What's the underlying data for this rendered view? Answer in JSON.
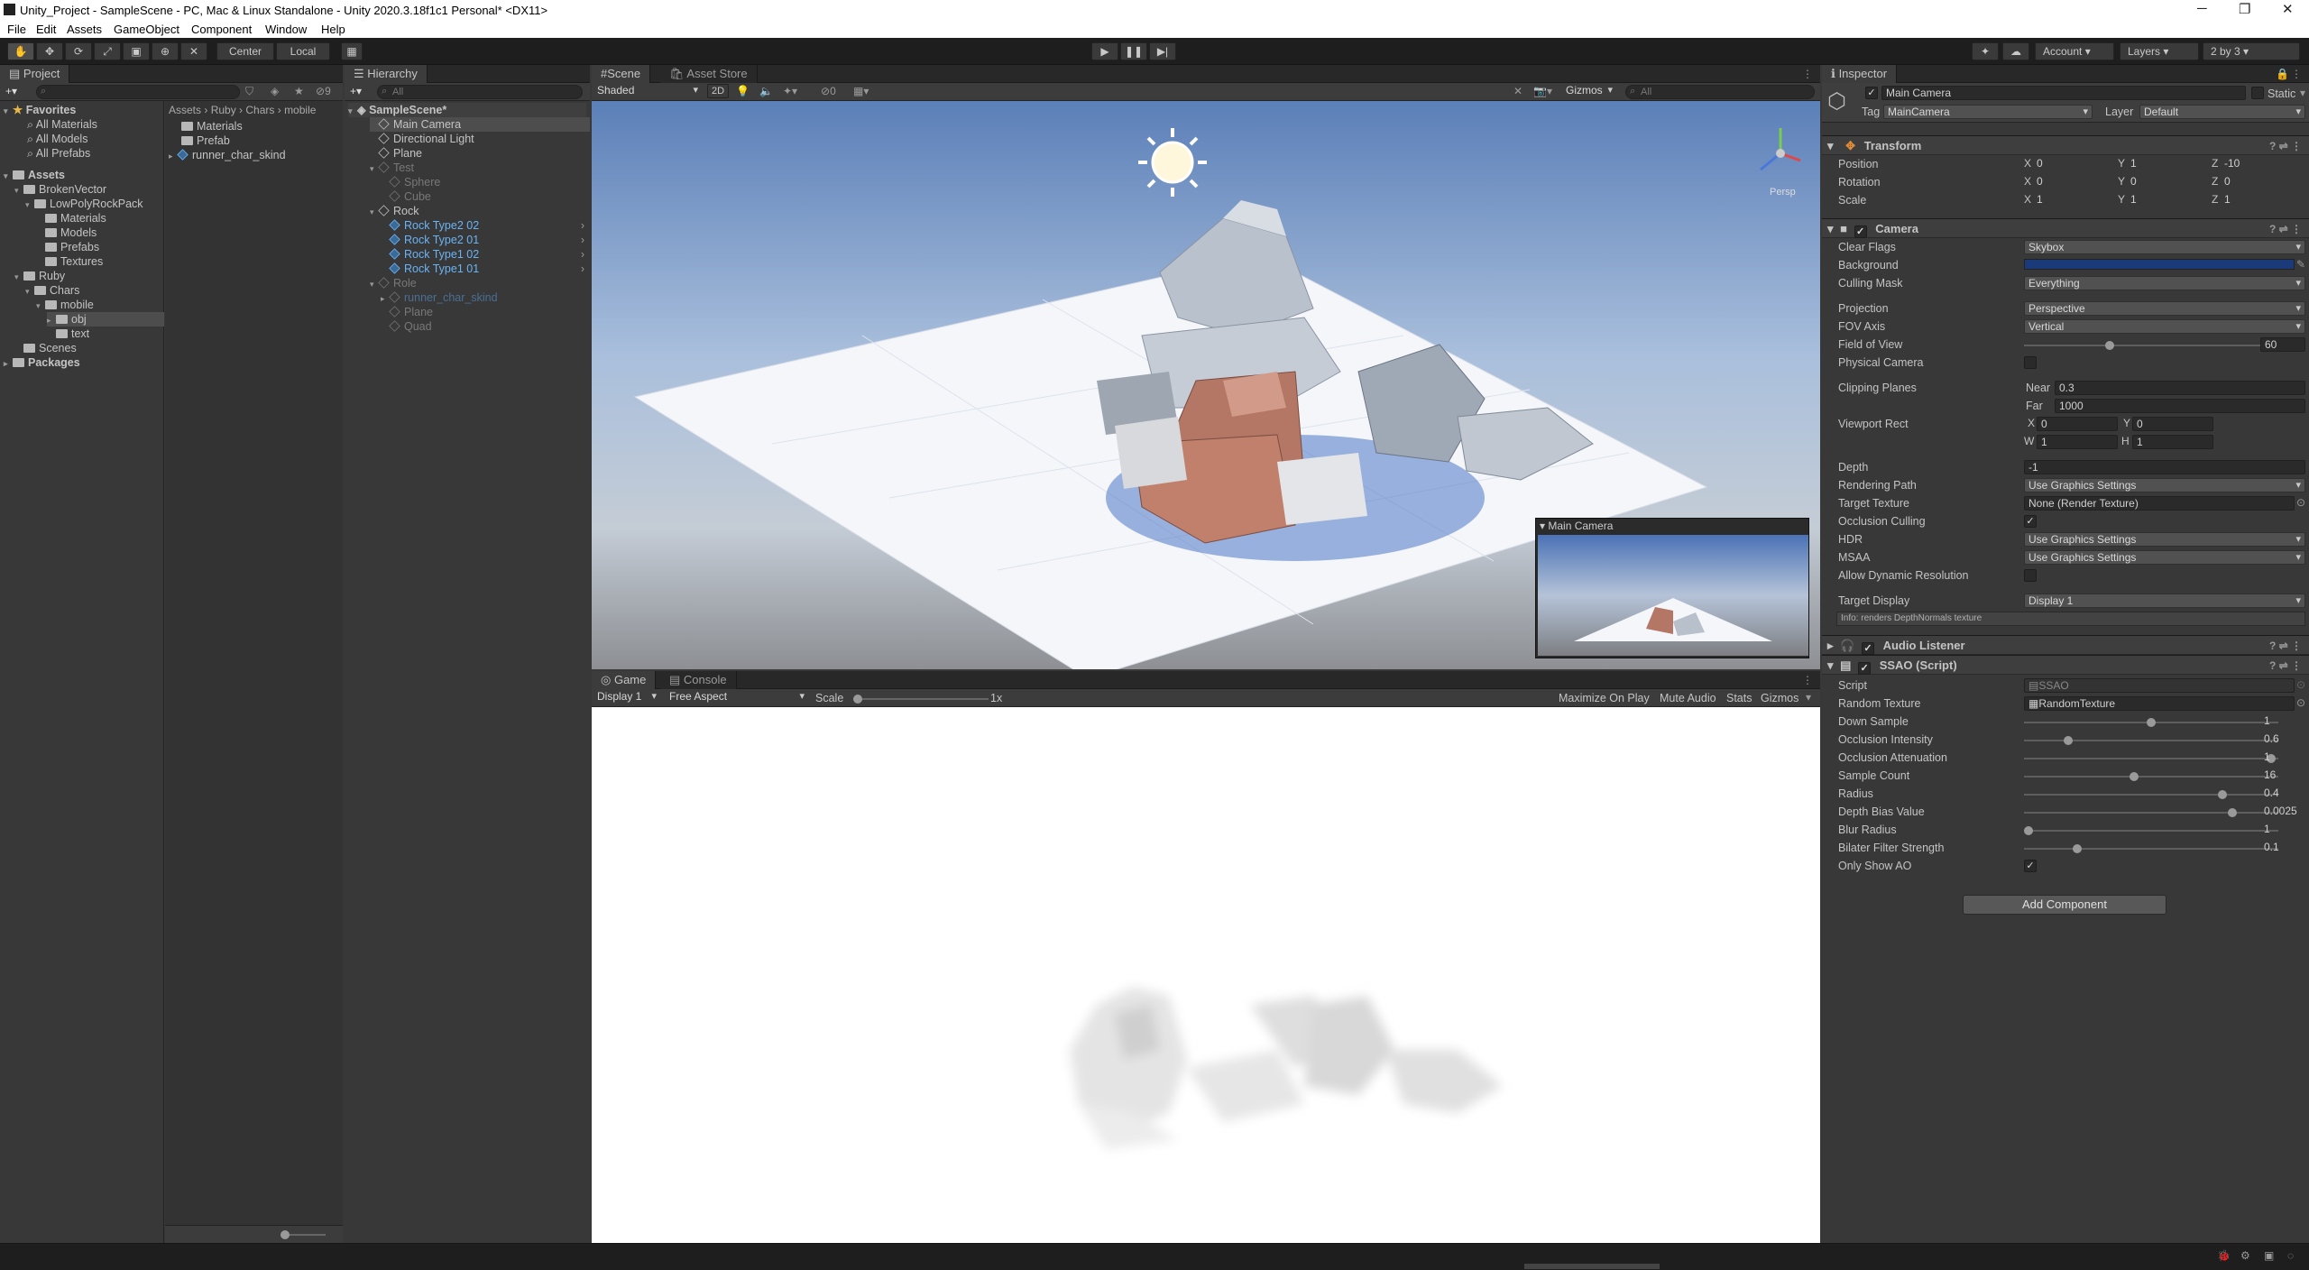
{
  "window": {
    "title": "Unity_Project - SampleScene - PC, Mac & Linux Standalone - Unity 2020.3.18f1c1 Personal* <DX11>"
  },
  "menu": [
    "File",
    "Edit",
    "Assets",
    "GameObject",
    "Component",
    "Window",
    "Help"
  ],
  "toolbar": {
    "center": "Center",
    "local": "Local",
    "account": "Account",
    "layers": "Layers",
    "layout": "2 by 3"
  },
  "project": {
    "tab": "Project",
    "favorites": {
      "label": "Favorites",
      "items": [
        "All Materials",
        "All Models",
        "All Prefabs"
      ]
    },
    "assets_label": "Assets",
    "tree": [
      {
        "label": "BrokenVector",
        "indent": 1
      },
      {
        "label": "LowPolyRockPack",
        "indent": 2
      },
      {
        "label": "Materials",
        "indent": 3
      },
      {
        "label": "Models",
        "indent": 3
      },
      {
        "label": "Prefabs",
        "indent": 3
      },
      {
        "label": "Textures",
        "indent": 3
      },
      {
        "label": "Ruby",
        "indent": 1
      },
      {
        "label": "Chars",
        "indent": 2
      },
      {
        "label": "mobile",
        "indent": 3
      },
      {
        "label": "obj",
        "indent": 4
      },
      {
        "label": "text",
        "indent": 4
      },
      {
        "label": "Scenes",
        "indent": 1
      },
      {
        "label": "Packages",
        "indent": 0
      }
    ],
    "breadcrumb": [
      "Assets",
      "Ruby",
      "Chars",
      "mobile"
    ],
    "files": [
      "Materials",
      "Prefab",
      "runner_char_skind"
    ],
    "hidden_count": "9"
  },
  "hierarchy": {
    "tab": "Hierarchy",
    "search_placeholder": "All",
    "scene": "SampleScene*",
    "items": [
      {
        "label": "Main Camera",
        "indent": 1,
        "style": "sel"
      },
      {
        "label": "Directional Light",
        "indent": 1,
        "style": ""
      },
      {
        "label": "Plane",
        "indent": 1,
        "style": ""
      },
      {
        "label": "Test",
        "indent": 1,
        "style": "dim"
      },
      {
        "label": "Sphere",
        "indent": 2,
        "style": "dim"
      },
      {
        "label": "Cube",
        "indent": 2,
        "style": "dim"
      },
      {
        "label": "Rock",
        "indent": 1,
        "style": ""
      },
      {
        "label": "Rock Type2 02",
        "indent": 2,
        "style": "blue"
      },
      {
        "label": "Rock Type2 01",
        "indent": 2,
        "style": "blue"
      },
      {
        "label": "Rock Type1 02",
        "indent": 2,
        "style": "blue"
      },
      {
        "label": "Rock Type1 01",
        "indent": 2,
        "style": "blue"
      },
      {
        "label": "Role",
        "indent": 1,
        "style": "dim"
      },
      {
        "label": "runner_char_skind",
        "indent": 2,
        "style": "dimblue"
      },
      {
        "label": "Plane",
        "indent": 2,
        "style": "dim"
      },
      {
        "label": "Quad",
        "indent": 2,
        "style": "dim"
      }
    ]
  },
  "scene": {
    "tabs": [
      "Scene",
      "Asset Store"
    ],
    "shading": "Shaded",
    "mode2d": "2D",
    "hidden": "0",
    "gizmos": "Gizmos",
    "search_placeholder": "All",
    "persp": "Persp",
    "preview_title": "Main Camera"
  },
  "game": {
    "tabs": [
      "Game",
      "Console"
    ],
    "display": "Display 1",
    "aspect": "Free Aspect",
    "scale_label": "Scale",
    "scale_value": "1x",
    "buttons": [
      "Maximize On Play",
      "Mute Audio",
      "Stats",
      "Gizmos"
    ]
  },
  "inspector": {
    "tab": "Inspector",
    "object_name": "Main Camera",
    "static_label": "Static",
    "tag_label": "Tag",
    "tag": "MainCamera",
    "layer_label": "Layer",
    "layer": "Default",
    "transform": {
      "title": "Transform",
      "rows": [
        {
          "label": "Position",
          "x": "0",
          "y": "1",
          "z": "-10"
        },
        {
          "label": "Rotation",
          "x": "0",
          "y": "0",
          "z": "0"
        },
        {
          "label": "Scale",
          "x": "1",
          "y": "1",
          "z": "1"
        }
      ]
    },
    "camera": {
      "title": "Camera",
      "clear_flags_label": "Clear Flags",
      "clear_flags": "Skybox",
      "background_label": "Background",
      "background_color": "#1b3a7a",
      "culling_mask_label": "Culling Mask",
      "culling_mask": "Everything",
      "projection_label": "Projection",
      "projection": "Perspective",
      "fov_axis_label": "FOV Axis",
      "fov_axis": "Vertical",
      "fov_label": "Field of View",
      "fov": "60",
      "fov_level": 0.33,
      "physical_label": "Physical Camera",
      "clipping_label": "Clipping Planes",
      "near_label": "Near",
      "near": "0.3",
      "far_label": "Far",
      "far": "1000",
      "viewport_label": "Viewport Rect",
      "vx": "0",
      "vy": "0",
      "vw": "1",
      "vh": "1",
      "depth_label": "Depth",
      "depth": "-1",
      "rendering_path_label": "Rendering Path",
      "rendering_path": "Use Graphics Settings",
      "target_texture_label": "Target Texture",
      "target_texture": "None (Render Texture)",
      "occlusion_label": "Occlusion Culling",
      "hdr_label": "HDR",
      "hdr": "Use Graphics Settings",
      "msaa_label": "MSAA",
      "msaa": "Use Graphics Settings",
      "dynres_label": "Allow Dynamic Resolution",
      "target_display_label": "Target Display",
      "target_display": "Display 1",
      "info": "Info: renders DepthNormals texture"
    },
    "audio": {
      "title": "Audio Listener"
    },
    "ssao": {
      "title": "SSAO (Script)",
      "script_label": "Script",
      "script": "SSAO",
      "random_texture_label": "Random Texture",
      "random_texture": "RandomTexture",
      "sliders": [
        {
          "label": "Down Sample",
          "value": "1",
          "level": 0.5
        },
        {
          "label": "Occlusion Intensity",
          "value": "0.6",
          "level": 0.16
        },
        {
          "label": "Occlusion Attenuation",
          "value": "1",
          "level": 0.99
        },
        {
          "label": "Sample Count",
          "value": "16",
          "level": 0.43
        },
        {
          "label": "Radius",
          "value": "0.4",
          "level": 0.79
        },
        {
          "label": "Depth Bias Value",
          "value": "0.0025",
          "level": 0.83
        },
        {
          "label": "Blur Radius",
          "value": "1",
          "level": 0.0
        },
        {
          "label": "Bilater Filter Strength",
          "value": "0.1",
          "level": 0.2
        }
      ],
      "only_show_ao_label": "Only Show AO"
    },
    "add_component": "Add Component"
  },
  "colors": {
    "accent": "#6ab4f5",
    "editor_bg": "#383838"
  }
}
